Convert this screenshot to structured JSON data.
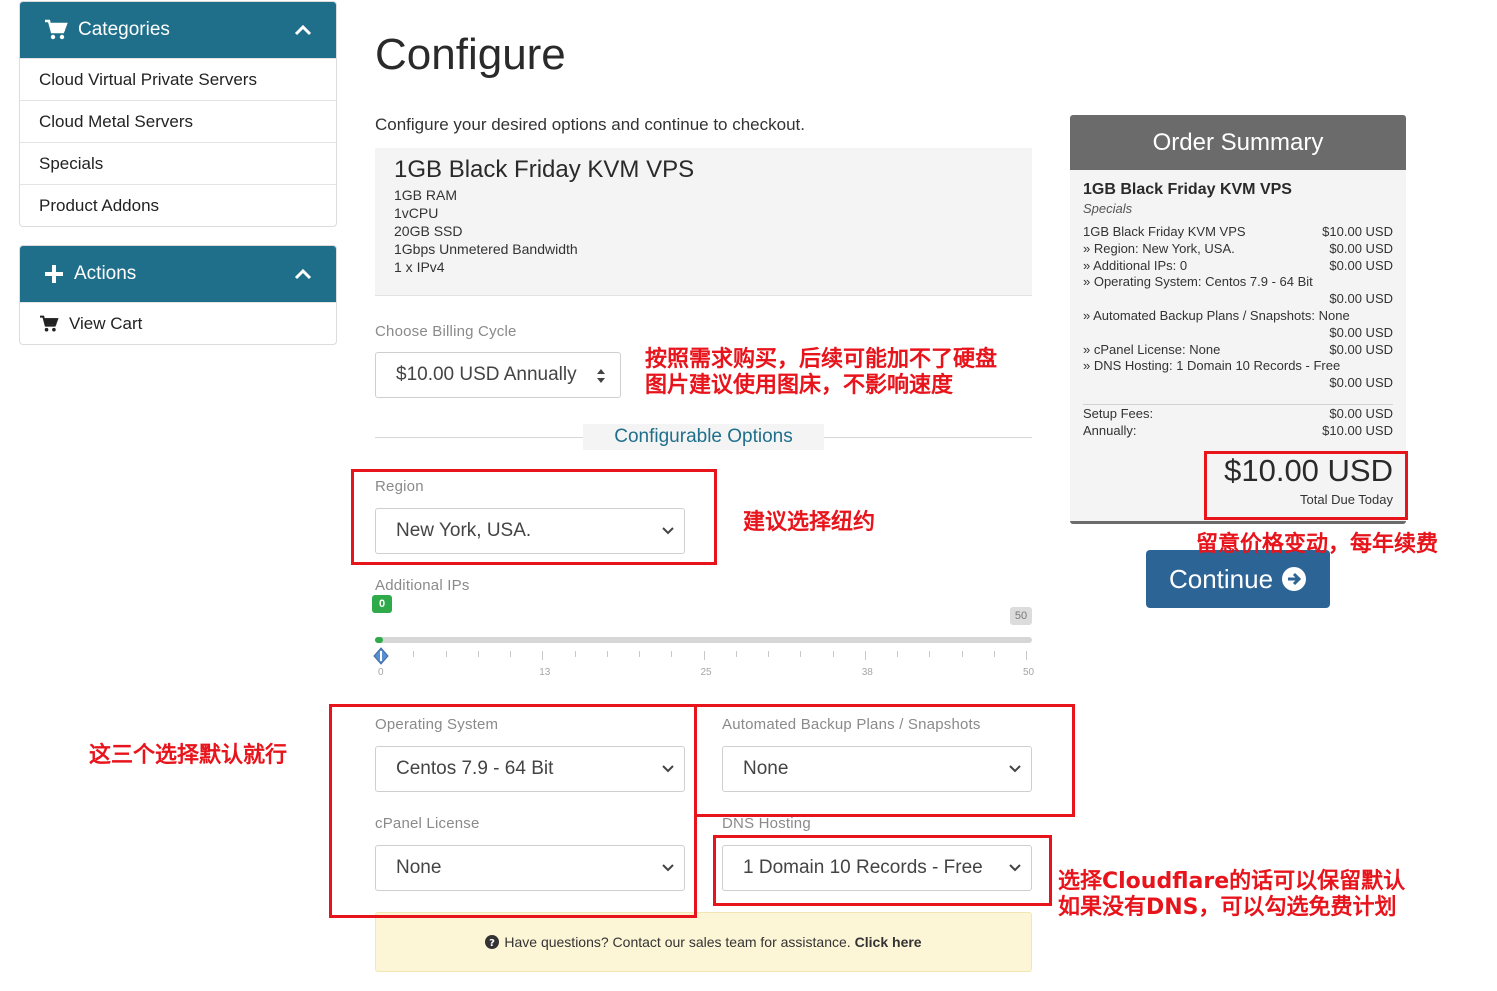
{
  "sidebar": {
    "categories_title": "Categories",
    "categories": [
      "Cloud Virtual Private Servers",
      "Cloud Metal Servers",
      "Specials",
      "Product Addons"
    ],
    "actions_title": "Actions",
    "actions": [
      "View Cart"
    ]
  },
  "main": {
    "title": "Configure",
    "subtitle": "Configure your desired options and continue to checkout.",
    "product": {
      "name": "1GB Black Friday KVM VPS",
      "specs": [
        "1GB RAM",
        "1vCPU",
        "20GB SSD",
        "1Gbps Unmetered Bandwidth",
        "1 x IPv4"
      ]
    },
    "billing": {
      "label": "Choose Billing Cycle",
      "value": "$10.00 USD Annually"
    },
    "configurable_title": "Configurable Options",
    "region": {
      "label": "Region",
      "value": "New York, USA."
    },
    "ips": {
      "label": "Additional IPs",
      "min": "0",
      "max": "50",
      "value": 0,
      "tick_labels": [
        "0",
        "13",
        "25",
        "38",
        "50"
      ]
    },
    "os": {
      "label": "Operating System",
      "value": "Centos 7.9 - 64 Bit"
    },
    "backup": {
      "label": "Automated Backup Plans / Snapshots",
      "value": "None"
    },
    "cpanel": {
      "label": "cPanel License",
      "value": "None"
    },
    "dns": {
      "label": "DNS Hosting",
      "value": "1 Domain 10 Records - Free"
    },
    "notice": {
      "text": "Have questions? Contact our sales team for assistance.",
      "link": "Click here"
    }
  },
  "summary": {
    "title": "Order Summary",
    "product": "1GB Black Friday KVM VPS",
    "category": "Specials",
    "lines": [
      {
        "label": "1GB Black Friday KVM VPS",
        "price": "$10.00 USD"
      },
      {
        "label": "» Region: New York, USA.",
        "price": "$0.00 USD"
      },
      {
        "label": "» Additional IPs: 0",
        "price": "$0.00 USD"
      },
      {
        "label": "» Operating System: Centos 7.9 - 64 Bit",
        "price": ""
      },
      {
        "label": "",
        "price": "$0.00 USD"
      },
      {
        "label": "» Automated Backup Plans / Snapshots: None",
        "price": ""
      },
      {
        "label": "",
        "price": "$0.00 USD"
      },
      {
        "label": "» cPanel License: None",
        "price": "$0.00 USD"
      },
      {
        "label": "» DNS Hosting: 1 Domain 10 Records - Free",
        "price": ""
      },
      {
        "label": "",
        "price": "$0.00 USD"
      }
    ],
    "setup_label": "Setup Fees:",
    "setup_value": "$0.00 USD",
    "recurring_label": "Annually:",
    "recurring_value": "$10.00 USD",
    "total": "$10.00 USD",
    "total_label": "Total Due Today",
    "continue": "Continue"
  },
  "annotations": {
    "billing_note_1": "按照需求购买，后续可能加不了硬盘",
    "billing_note_2": "图片建议使用图床，不影响速度",
    "region_note": "建议选择纽约",
    "defaults_note": "这三个选择默认就行",
    "price_note": "留意价格变动，每年续费",
    "dns_note_1": "选择Cloudflare的话可以保留默认",
    "dns_note_2": "如果没有DNS，可以勾选免费计划"
  },
  "colors": {
    "sidebar_header": "#1f6f8b",
    "continue_button": "#2d6496",
    "annotation_red": "#e8141c",
    "slider_green": "#2eaa4a",
    "summary_header": "#6b6b6b"
  }
}
